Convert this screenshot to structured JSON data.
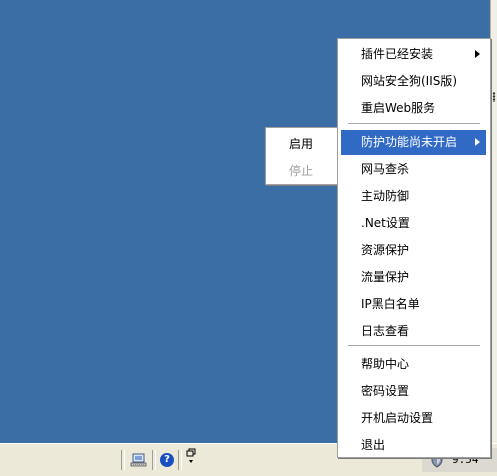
{
  "menu": {
    "items": [
      {
        "label": "插件已经安装",
        "has_submenu": true
      },
      {
        "label": "网站安全狗(IIS版)"
      },
      {
        "label": "重启Web服务"
      },
      {
        "label": "防护功能尚未开启",
        "has_submenu": true,
        "highlighted": true
      },
      {
        "label": "网马查杀"
      },
      {
        "label": "主动防御"
      },
      {
        "label": ".Net设置"
      },
      {
        "label": "资源保护"
      },
      {
        "label": "流量保护"
      },
      {
        "label": "IP黑白名单"
      },
      {
        "label": "日志查看"
      },
      {
        "label": "帮助中心"
      },
      {
        "label": "密码设置"
      },
      {
        "label": "开机启动设置"
      },
      {
        "label": "退出"
      }
    ]
  },
  "submenu": {
    "items": [
      {
        "label": "启用",
        "enabled": true
      },
      {
        "label": "停止",
        "enabled": false
      }
    ]
  },
  "taskbar": {
    "clock": "9:54",
    "icons": [
      "network-icon",
      "help-icon",
      "window-restore-icon",
      "shield-tray-icon"
    ]
  },
  "colors": {
    "desktop": "#3a6ea5",
    "highlight": "#316ac5",
    "taskbar": "#ece9d8"
  }
}
